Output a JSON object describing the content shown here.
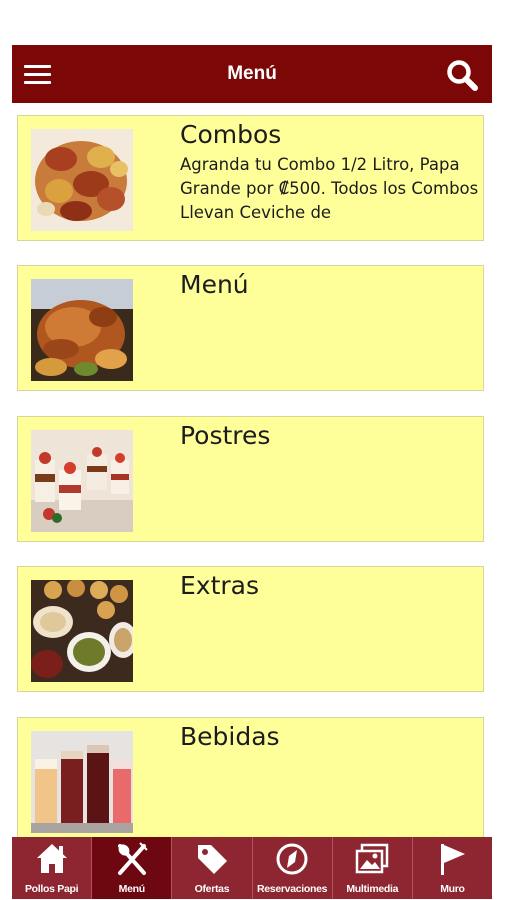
{
  "header": {
    "title": "Menú",
    "menu_icon": "hamburger-menu-icon",
    "search_icon": "search-icon",
    "background": "#7b0707"
  },
  "categories": [
    {
      "title": "Combos",
      "description": "Agranda tu Combo 1/2 Litro, Papa Grande por ₡500. Todos los Combos Llevan Ceviche de",
      "image": "roasted-chicken-pieces-with-potatoes"
    },
    {
      "title": "Menú",
      "description": "",
      "image": "whole-roast-chicken"
    },
    {
      "title": "Postres",
      "description": "",
      "image": "layered-dessert-cups"
    },
    {
      "title": "Extras",
      "description": "",
      "image": "side-dishes-platter"
    },
    {
      "title": "Bebidas",
      "description": "",
      "image": "assorted-drinks"
    }
  ],
  "tabs": [
    {
      "label": "Pollos Papi",
      "icon": "home-icon",
      "active": false
    },
    {
      "label": "Menú",
      "icon": "fork-knife-icon",
      "active": true
    },
    {
      "label": "Ofertas",
      "icon": "tag-icon",
      "active": false
    },
    {
      "label": "Reservaciones",
      "icon": "compass-icon",
      "active": false
    },
    {
      "label": "Multimedia",
      "icon": "gallery-icon",
      "active": false
    },
    {
      "label": "Muro",
      "icon": "flag-icon",
      "active": false
    }
  ],
  "colors": {
    "card_background": "#ffff99",
    "tabbar_background": "#8d2631",
    "tab_active": "#6e0810"
  }
}
